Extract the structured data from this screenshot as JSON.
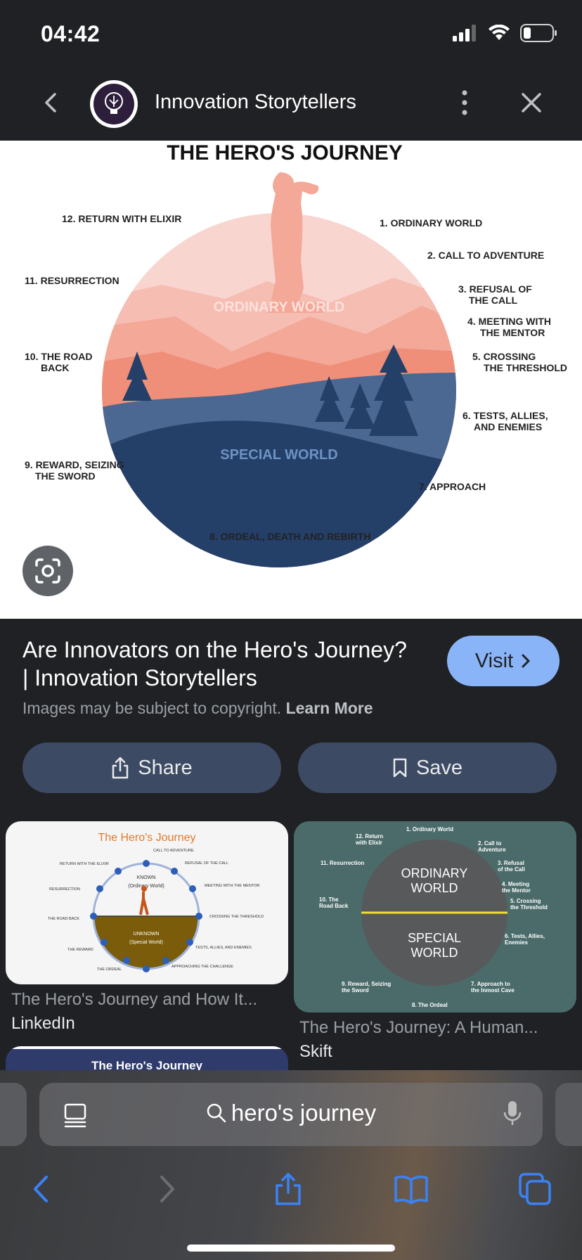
{
  "status": {
    "time": "04:42"
  },
  "header": {
    "site_title": "Innovation Storytellers"
  },
  "hero": {
    "title": "THE HERO'S JOURNEY",
    "ordinary_world": "ORDINARY WORLD",
    "special_world": "SPECIAL WORLD",
    "stages": [
      "12. RETURN WITH ELIXIR",
      "1. ORDINARY WORLD",
      "2. CALL TO ADVENTURE",
      "11. RESURRECTION",
      "3. REFUSAL OF",
      "THE CALL",
      "4. MEETING WITH",
      "THE MENTOR",
      "10. THE ROAD",
      "BACK",
      "5. CROSSING",
      "THE THRESHOLD",
      "6. TESTS, ALLIES,",
      "AND ENEMIES",
      "9. REWARD, SEIZING",
      "THE SWORD",
      "7. APPROACH",
      "8. ORDEAL, DEATH AND REBIRTH"
    ],
    "colors": {
      "sky_light": "#f9d5d0",
      "mountain_mid": "#f4a898",
      "mountain_dark": "#f08f79",
      "blue_light": "#4a6891",
      "blue_dark": "#243f68"
    }
  },
  "result": {
    "title": "Are Innovators on the Hero's Journey? | Innovation Storytellers",
    "visit_label": "Visit",
    "copyright_text": "Images may be subject to copyright.",
    "learn_more": "Learn More",
    "share_label": "Share",
    "save_label": "Save"
  },
  "thumbs": [
    {
      "title": "The Hero's Journey and How It...",
      "source": "LinkedIn",
      "heading": "The Hero's Journey",
      "known": "KNOWN",
      "known_sub": "(Ordinary World)",
      "unknown": "UNKNOWN",
      "unknown_sub": "(Special World)",
      "labels": [
        "CALL TO ADVENTURE",
        "REFUSAL OF THE CALL",
        "MEETING WITH THE MENTOR",
        "CROSSING THE THRESHOLD",
        "TESTS, ALLIES, AND ENEMIES",
        "APPROACHING THE CHALLENGE",
        "THE ORDEAL",
        "THE REWARD",
        "THE ROAD BACK",
        "RESURRECTION",
        "RETURN WITH THE ELIXIR"
      ]
    },
    {
      "title": "The Hero's Journey: A Human...",
      "source": "Skift",
      "ordinary": "ORDINARY",
      "world": "WORLD",
      "special": "SPECIAL",
      "labels": [
        "1. Ordinary World",
        "12. Return",
        "with Elixir",
        "2. Call to",
        "Adventure",
        "11. Resurrection",
        "3. Refusal",
        "of the Call",
        "4. Meeting",
        "the Mentor",
        "10. The",
        "Road Back",
        "5. Crossing",
        "the Threshold",
        "6. Tests, Allies,",
        "Enemies",
        "9. Reward, Seizing",
        "the Sword",
        "7. Approach to",
        "the Inmost Cave",
        "8. The Ordeal"
      ]
    },
    {
      "heading": "The Hero's Journey"
    }
  ],
  "search": {
    "query": "hero's journey"
  },
  "accent": "#8ab4f8"
}
